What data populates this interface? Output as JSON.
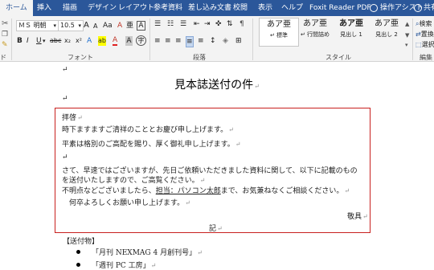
{
  "ribbon": {
    "tabs": [
      {
        "label": "ホーム",
        "active": true
      },
      {
        "label": "挿入"
      },
      {
        "label": "描画"
      },
      {
        "label": "デザイン"
      },
      {
        "label": "レイアウト"
      },
      {
        "label": "参考資料"
      },
      {
        "label": "差し込み文書"
      },
      {
        "label": "校閲"
      },
      {
        "label": "表示"
      },
      {
        "label": "ヘルプ"
      },
      {
        "label": "Foxit Reader PDF"
      },
      {
        "label": "操作アシスト"
      },
      {
        "label": "共有"
      }
    ],
    "font": {
      "name": "ＭＳ 明朝",
      "size": "10.5",
      "group_label": "フォント",
      "bold": "B",
      "italic": "I",
      "underline": "U",
      "strike": "abc",
      "sub": "x₂",
      "sup": "x²",
      "grow": "A",
      "shrink": "A",
      "aa": "Aa",
      "clear": "A",
      "phonetic": "亜",
      "enclose": "A",
      "highlight": "ab",
      "font_color": "A",
      "char_shade": "A",
      "char_circle": "字"
    },
    "paragraph": {
      "group_label": "段落"
    },
    "styles": {
      "group_label": "スタイル",
      "items": [
        {
          "preview": "あア亜",
          "name": "↵ 標準",
          "selected": true
        },
        {
          "preview": "あア亜",
          "name": "↵ 行間詰め"
        },
        {
          "preview": "あア亜",
          "name": "見出し 1",
          "bold": true
        },
        {
          "preview": "あア亜",
          "name": "見出し 2"
        }
      ]
    },
    "editing": {
      "group_label": "編集",
      "find": "検索",
      "replace": "置換",
      "select": "選択"
    },
    "left_edge_label": "ド"
  },
  "document": {
    "title": "見本誌送付の件",
    "lines": [
      "拝啓",
      "時下ますますご清祥のこととお慶び申し上げます。",
      "平素は格別のご高配を賜り、厚く御礼申し上げます。",
      "さて、早速ではございますが、先日ご依頼いただきました資料に関して、以下に記載のもの",
      "を送付いたしますので、ご高覧ください。",
      "何卒よろしくお願い申し上げます。",
      "敬具",
      "記",
      "【送付物】",
      "「月刊 NEXMAG 4 月創刊号」",
      "「週刊 PC 工房」"
    ],
    "inquiry": {
      "before": "不明点などございましたら、",
      "contact": "担当：パソコン太郎",
      "after": "まで、お気兼ねなくご相談ください。"
    },
    "para_mark": "↵"
  }
}
